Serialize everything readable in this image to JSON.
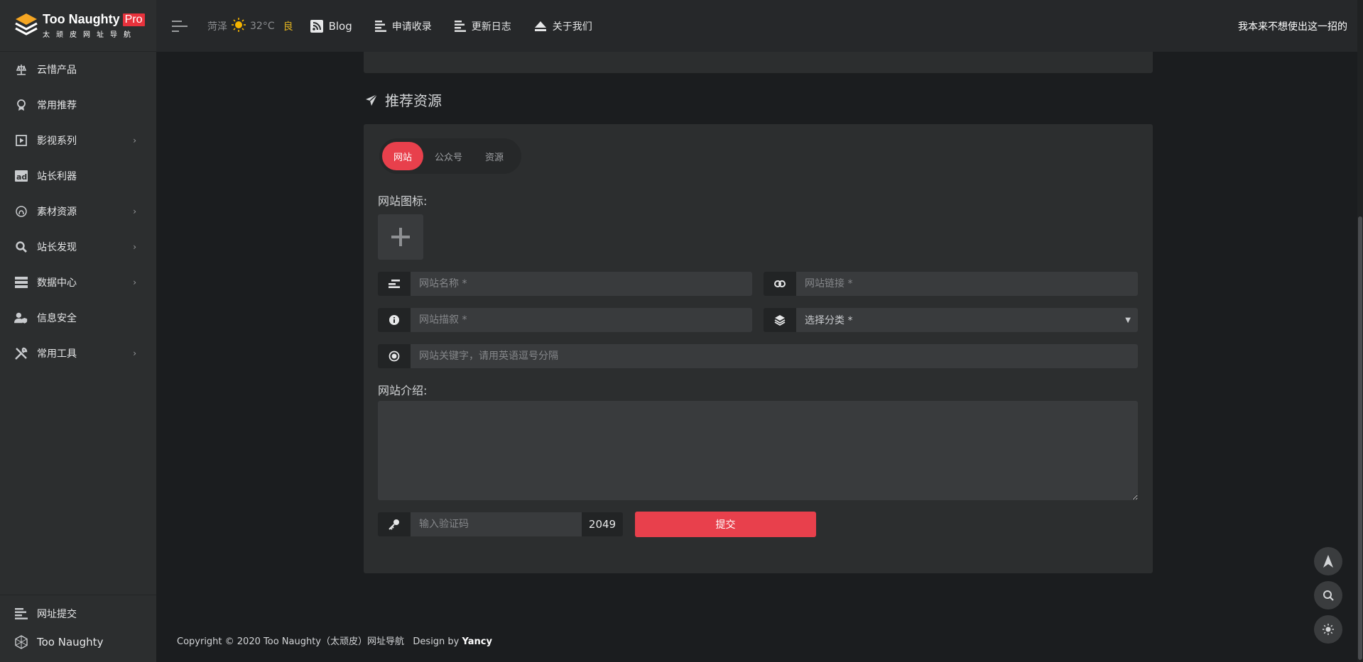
{
  "brand": {
    "name": "Too Naughty",
    "badge": "Pro",
    "subtitle": "太顽皮网址导航"
  },
  "sidebar": {
    "items": [
      {
        "label": "云惜产品",
        "icon": "scale-icon",
        "has_children": false
      },
      {
        "label": "常用推荐",
        "icon": "award-icon",
        "has_children": false
      },
      {
        "label": "影视系列",
        "icon": "play-icon",
        "has_children": true
      },
      {
        "label": "站长利器",
        "icon": "ad-icon",
        "has_children": false
      },
      {
        "label": "素材资源",
        "icon": "fingerprint-icon",
        "has_children": true
      },
      {
        "label": "站长发现",
        "icon": "search-icon",
        "has_children": true
      },
      {
        "label": "数据中心",
        "icon": "server-icon",
        "has_children": true
      },
      {
        "label": "信息安全",
        "icon": "user-shield-icon",
        "has_children": false
      },
      {
        "label": "常用工具",
        "icon": "tools-icon",
        "has_children": true
      }
    ],
    "bottom": [
      {
        "label": "网址提交",
        "icon": "align-left-icon"
      },
      {
        "label": "Too Naughty",
        "icon": "sphere-icon"
      }
    ]
  },
  "header": {
    "weather": {
      "city": "菏泽",
      "temp": "32°C",
      "air_quality": "良",
      "air_color": "#e2b31f"
    },
    "nav": [
      {
        "label": "Blog",
        "icon": "rss-icon"
      },
      {
        "label": "申请收录",
        "icon": "align-left-icon"
      },
      {
        "label": "更新日志",
        "icon": "align-left-icon"
      },
      {
        "label": "关于我们",
        "icon": "eject-icon"
      }
    ],
    "motto": "我本来不想使出这一招的"
  },
  "section": {
    "title": "推荐资源",
    "icon": "paper-plane-icon"
  },
  "form": {
    "tabs": [
      {
        "label": "网站",
        "active": true
      },
      {
        "label": "公众号",
        "active": false
      },
      {
        "label": "资源",
        "active": false
      }
    ],
    "icon_label": "网站图标:",
    "name_placeholder": "网站名称 *",
    "link_placeholder": "网站链接 *",
    "desc_placeholder": "网站描叙 *",
    "category_placeholder": "选择分类 *",
    "keywords_placeholder": "网站关键字，请用英语逗号分隔",
    "intro_label": "网站介绍:",
    "captcha_placeholder": "输入验证码",
    "captcha_code": "2049",
    "submit_label": "提交"
  },
  "footer": {
    "copyright": "Copyright © 2020 Too Naughty（太顽皮）网址导航",
    "design_prefix": "Design by",
    "designer": "Yancy"
  },
  "colors": {
    "accent": "#e8404c",
    "sidebar_bg": "#2c2e2f",
    "page_bg": "#1b1d1f"
  }
}
